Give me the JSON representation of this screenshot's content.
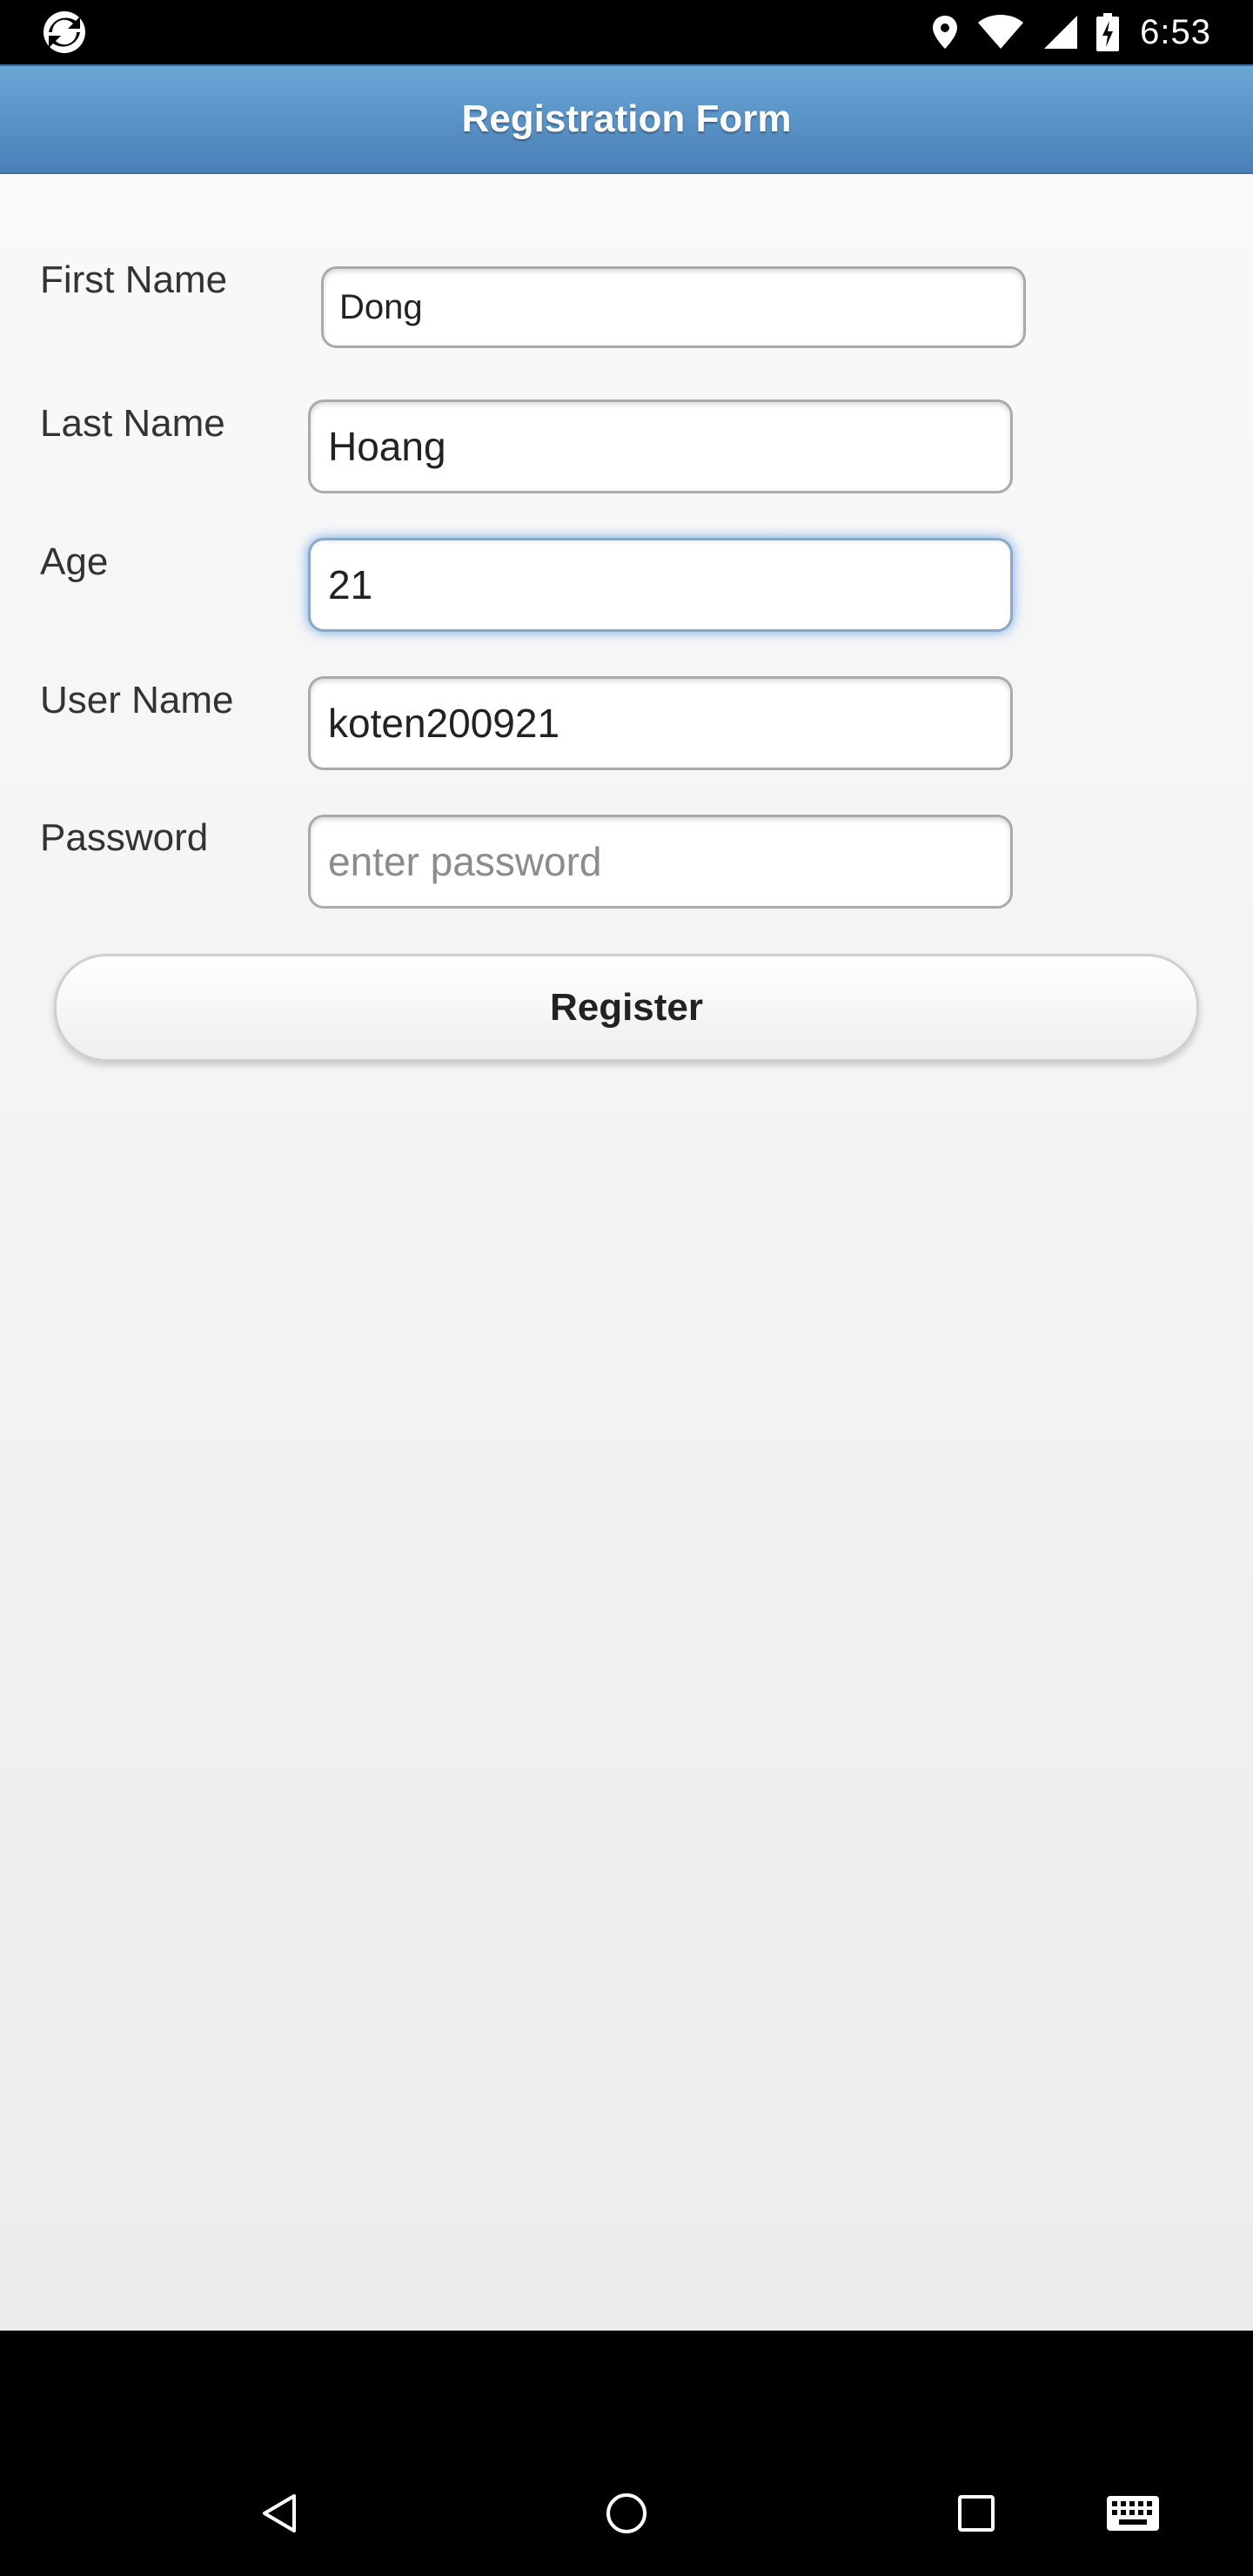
{
  "status_bar": {
    "time": "6:53",
    "icons": [
      "app-sync-icon",
      "location-icon",
      "wifi-icon",
      "signal-icon",
      "battery-charging-icon"
    ]
  },
  "header": {
    "title": "Registration Form"
  },
  "form": {
    "fields": [
      {
        "label": "First Name",
        "value": "Dong",
        "placeholder": ""
      },
      {
        "label": "Last Name",
        "value": "Hoang",
        "placeholder": ""
      },
      {
        "label": "Age",
        "value": "21",
        "placeholder": ""
      },
      {
        "label": "User Name",
        "value": "koten200921",
        "placeholder": ""
      },
      {
        "label": "Password",
        "value": "",
        "placeholder": "enter password"
      }
    ],
    "submit_label": "Register"
  },
  "nav_bar": {
    "icons": [
      "back-icon",
      "home-icon",
      "recents-icon",
      "keyboard-icon"
    ]
  },
  "colors": {
    "header_top": "#6aa6d6",
    "header_bottom": "#4a80b8",
    "focus_glow": "#3888dc"
  }
}
